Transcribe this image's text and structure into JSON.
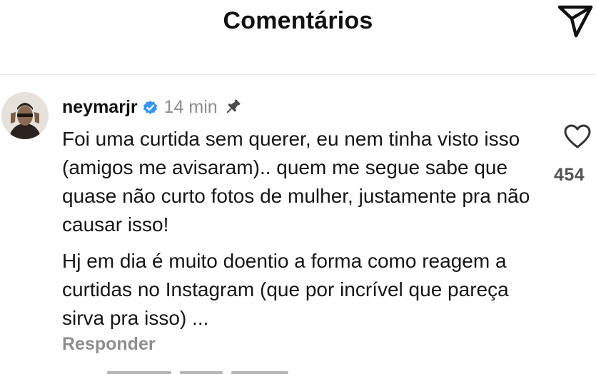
{
  "header": {
    "title": "Comentários",
    "share_icon": "paper-plane-icon"
  },
  "comment": {
    "avatar_icon": "avatar",
    "username": "neymarjr",
    "verified_icon": "verified-badge-icon",
    "verified_color": "#3897f0",
    "time": "14 min",
    "pin_icon": "pin-icon",
    "paragraphs": [
      "Foi uma curtida sem querer, eu nem tinha visto isso (amigos me avisaram).. quem me segue sabe que quase não curto fotos de mulher, justamente pra não causar isso!",
      "Hj em dia é muito doentio a forma como reagem a curtidas no Instagram (que por incrível que pareça sirva pra isso) ..."
    ],
    "reply_label": "Responder",
    "like_icon": "heart-icon",
    "like_count": "454"
  }
}
